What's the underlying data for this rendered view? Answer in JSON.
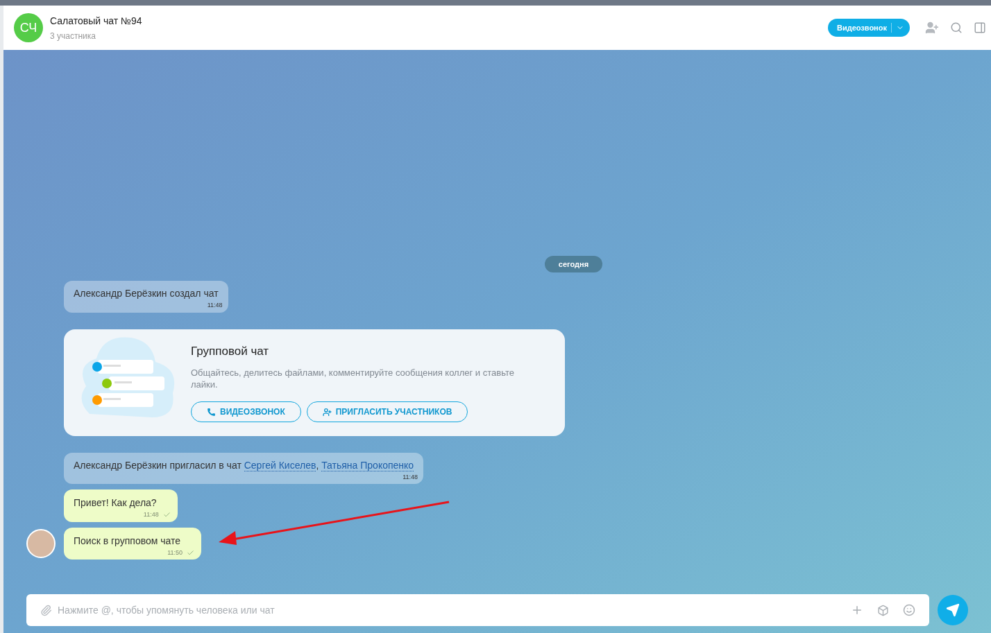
{
  "header": {
    "avatar_initials": "СЧ",
    "title": "Салатовый чат №94",
    "subtitle": "3 участника",
    "video_button": "Видеозвонок"
  },
  "date_divider": "сегодня",
  "messages": [
    {
      "kind": "system",
      "parts": [
        {
          "text": "Александр Берёзкин создал чат",
          "link": false
        }
      ],
      "time": "11:48"
    },
    {
      "kind": "card",
      "title": "Групповой чат",
      "description": "Общайтесь, делитесь файлами, комментируйте сообщения коллег и ставьте лайки.",
      "buttons": [
        "ВИДЕОЗВОНОК",
        "ПРИГЛАСИТЬ УЧАСТНИКОВ"
      ]
    },
    {
      "kind": "system",
      "parts": [
        {
          "text": "Александр Берёзкин пригласил в чат ",
          "link": false
        },
        {
          "text": "Сергей Киселев",
          "link": true
        },
        {
          "text": ", ",
          "link": false
        },
        {
          "text": "Татьяна Прокопенко",
          "link": true
        }
      ],
      "time": "11:48"
    },
    {
      "kind": "outgoing",
      "text": "Привет! Как дела?",
      "time": "11:48",
      "delivered": true,
      "avatar": false
    },
    {
      "kind": "outgoing",
      "text": "Поиск в групповом чате",
      "time": "11:50",
      "delivered": true,
      "avatar": true
    }
  ],
  "composer": {
    "placeholder": "Нажмите @, чтобы упомянуть человека или чат"
  }
}
